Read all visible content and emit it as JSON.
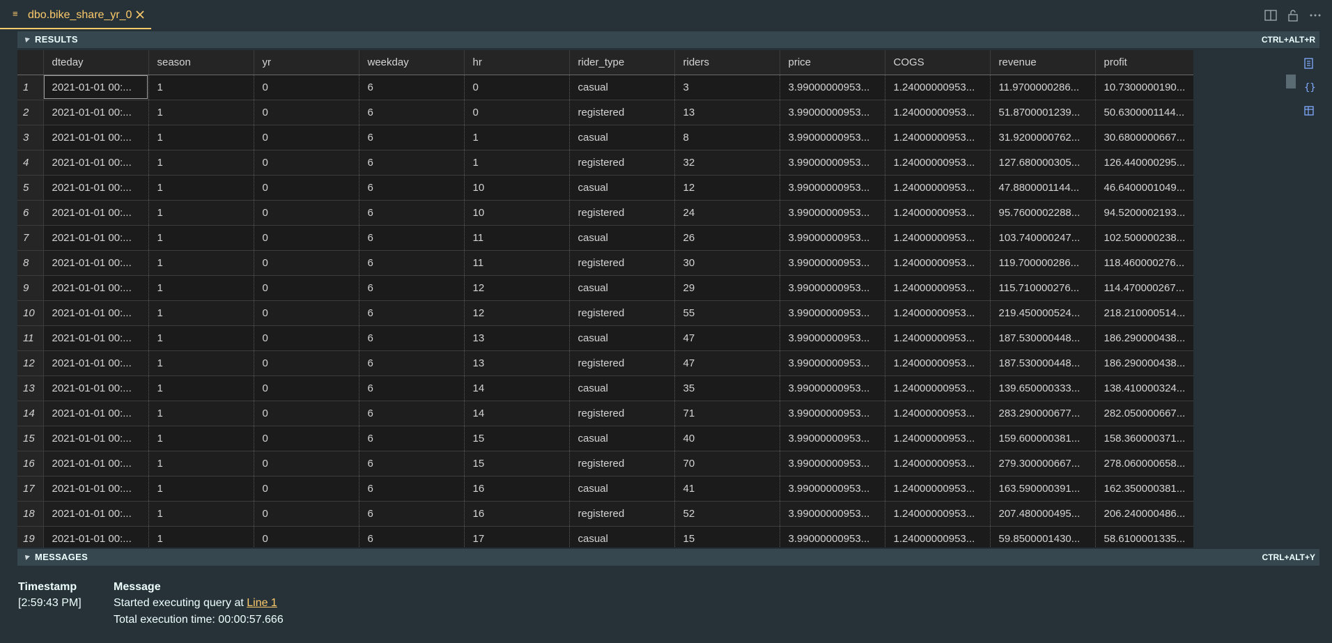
{
  "tab": {
    "title": "dbo.bike_share_yr_0",
    "menu_glyph": "≡",
    "close_icon": "close-icon"
  },
  "top_actions": [
    "split-editor-icon",
    "lock-icon",
    "more-actions-icon"
  ],
  "results": {
    "label": "RESULTS",
    "shortcut": "CTRL+ALT+R",
    "columns": [
      "dteday",
      "season",
      "yr",
      "weekday",
      "hr",
      "rider_type",
      "riders",
      "price",
      "COGS",
      "revenue",
      "profit"
    ],
    "rows": [
      [
        "1",
        "2021-01-01 00:...",
        "1",
        "0",
        "6",
        "0",
        "casual",
        "3",
        "3.99000000953...",
        "1.24000000953...",
        "11.9700000286...",
        "10.7300000190..."
      ],
      [
        "2",
        "2021-01-01 00:...",
        "1",
        "0",
        "6",
        "0",
        "registered",
        "13",
        "3.99000000953...",
        "1.24000000953...",
        "51.8700001239...",
        "50.6300001144..."
      ],
      [
        "3",
        "2021-01-01 00:...",
        "1",
        "0",
        "6",
        "1",
        "casual",
        "8",
        "3.99000000953...",
        "1.24000000953...",
        "31.9200000762...",
        "30.6800000667..."
      ],
      [
        "4",
        "2021-01-01 00:...",
        "1",
        "0",
        "6",
        "1",
        "registered",
        "32",
        "3.99000000953...",
        "1.24000000953...",
        "127.680000305...",
        "126.440000295..."
      ],
      [
        "5",
        "2021-01-01 00:...",
        "1",
        "0",
        "6",
        "10",
        "casual",
        "12",
        "3.99000000953...",
        "1.24000000953...",
        "47.8800001144...",
        "46.6400001049..."
      ],
      [
        "6",
        "2021-01-01 00:...",
        "1",
        "0",
        "6",
        "10",
        "registered",
        "24",
        "3.99000000953...",
        "1.24000000953...",
        "95.7600002288...",
        "94.5200002193..."
      ],
      [
        "7",
        "2021-01-01 00:...",
        "1",
        "0",
        "6",
        "11",
        "casual",
        "26",
        "3.99000000953...",
        "1.24000000953...",
        "103.740000247...",
        "102.500000238..."
      ],
      [
        "8",
        "2021-01-01 00:...",
        "1",
        "0",
        "6",
        "11",
        "registered",
        "30",
        "3.99000000953...",
        "1.24000000953...",
        "119.700000286...",
        "118.460000276..."
      ],
      [
        "9",
        "2021-01-01 00:...",
        "1",
        "0",
        "6",
        "12",
        "casual",
        "29",
        "3.99000000953...",
        "1.24000000953...",
        "115.710000276...",
        "114.470000267..."
      ],
      [
        "10",
        "2021-01-01 00:...",
        "1",
        "0",
        "6",
        "12",
        "registered",
        "55",
        "3.99000000953...",
        "1.24000000953...",
        "219.450000524...",
        "218.210000514..."
      ],
      [
        "11",
        "2021-01-01 00:...",
        "1",
        "0",
        "6",
        "13",
        "casual",
        "47",
        "3.99000000953...",
        "1.24000000953...",
        "187.530000448...",
        "186.290000438..."
      ],
      [
        "12",
        "2021-01-01 00:...",
        "1",
        "0",
        "6",
        "13",
        "registered",
        "47",
        "3.99000000953...",
        "1.24000000953...",
        "187.530000448...",
        "186.290000438..."
      ],
      [
        "13",
        "2021-01-01 00:...",
        "1",
        "0",
        "6",
        "14",
        "casual",
        "35",
        "3.99000000953...",
        "1.24000000953...",
        "139.650000333...",
        "138.410000324..."
      ],
      [
        "14",
        "2021-01-01 00:...",
        "1",
        "0",
        "6",
        "14",
        "registered",
        "71",
        "3.99000000953...",
        "1.24000000953...",
        "283.290000677...",
        "282.050000667..."
      ],
      [
        "15",
        "2021-01-01 00:...",
        "1",
        "0",
        "6",
        "15",
        "casual",
        "40",
        "3.99000000953...",
        "1.24000000953...",
        "159.600000381...",
        "158.360000371..."
      ],
      [
        "16",
        "2021-01-01 00:...",
        "1",
        "0",
        "6",
        "15",
        "registered",
        "70",
        "3.99000000953...",
        "1.24000000953...",
        "279.300000667...",
        "278.060000658..."
      ],
      [
        "17",
        "2021-01-01 00:...",
        "1",
        "0",
        "6",
        "16",
        "casual",
        "41",
        "3.99000000953...",
        "1.24000000953...",
        "163.590000391...",
        "162.350000381..."
      ],
      [
        "18",
        "2021-01-01 00:...",
        "1",
        "0",
        "6",
        "16",
        "registered",
        "52",
        "3.99000000953...",
        "1.24000000953...",
        "207.480000495...",
        "206.240000486..."
      ],
      [
        "19",
        "2021-01-01 00:...",
        "1",
        "0",
        "6",
        "17",
        "casual",
        "15",
        "3.99000000953...",
        "1.24000000953...",
        "59.8500001430...",
        "58.6100001335..."
      ]
    ]
  },
  "side_actions": [
    "save-as-csv-icon",
    "save-as-json-icon",
    "save-as-excel-icon"
  ],
  "messages": {
    "label": "MESSAGES",
    "shortcut": "CTRL+ALT+Y",
    "timestamp_header": "Timestamp",
    "message_header": "Message",
    "timestamp": "[2:59:43 PM]",
    "line1_prefix": "Started executing query at ",
    "line1_link": "Line 1",
    "line2": "Total execution time: 00:00:57.666"
  },
  "colors": {
    "background": "#263238",
    "accent": "#ffcb6b",
    "grid_background": "#1e1e1e",
    "header_bar": "#37474f"
  }
}
